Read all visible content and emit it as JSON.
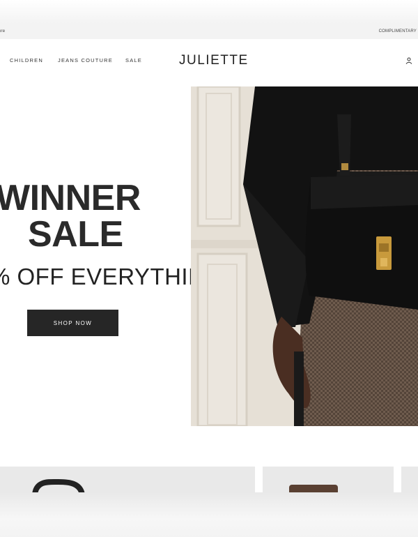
{
  "promo_bar": {
    "left_text": "ore",
    "right_text": "COMPLIMENTARY"
  },
  "header": {
    "nav_items": [
      "CHILDREN",
      "JEANS COUTURE",
      "SALE"
    ],
    "logo": "JULIETTE",
    "account_icon": "user-icon"
  },
  "hero": {
    "title_line1": "WINNER",
    "title_line2": "SALE",
    "subtitle": "% OFF EVERYTHING",
    "cta_label": "SHOP NOW"
  },
  "colors": {
    "button_bg": "#262626",
    "text_dark": "#2a2a2a",
    "promo_bg": "#f3f3f3"
  }
}
